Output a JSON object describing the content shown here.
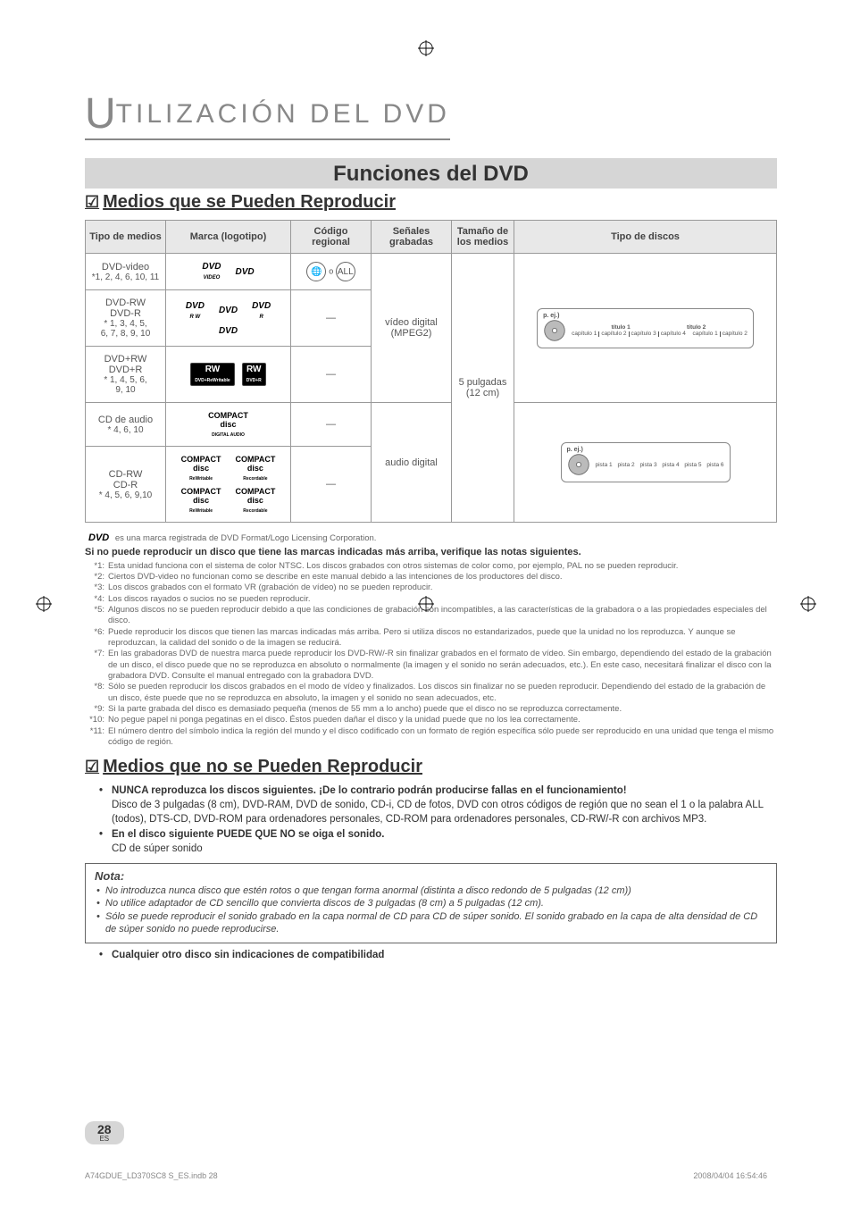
{
  "section_header": "TILIZACIÓN DEL DVD",
  "section_header_bigletter": "U",
  "main_title": "Funciones del DVD",
  "sub1_title": "Medios que se Pueden Reproducir",
  "table": {
    "headers": {
      "type": "Tipo de medios",
      "brand": "Marca (logotipo)",
      "region": "Código regional",
      "signal": "Señales grabadas",
      "size": "Tamaño de los medios",
      "discs": "Tipo de discos"
    },
    "rows": [
      {
        "type": "DVD-video",
        "type_note": "*1, 2, 4, 6, 10, 11",
        "region": "1 o ALL"
      },
      {
        "type": "DVD-RW\nDVD-R",
        "type_note": "* 1, 3, 4, 5,\n6, 7, 8, 9, 10",
        "region": "—"
      },
      {
        "type": "DVD+RW\nDVD+R",
        "type_note": "* 1, 4, 5, 6,\n9, 10",
        "region": "—"
      },
      {
        "type": "CD de audio",
        "type_note": "* 4, 6, 10",
        "region": "—"
      },
      {
        "type": "CD-RW\nCD-R",
        "type_note": "* 4, 5, 6, 9,10",
        "region": "—"
      }
    ],
    "signal_video": "vídeo digital\n(MPEG2)",
    "signal_audio": "audio digital",
    "size": "5 pulgadas\n(12 cm)",
    "diagram_video": {
      "eg": "p. ej.)",
      "t1": "título 1",
      "t2": "título 2",
      "chapters": [
        "capítulo 1",
        "capítulo 2",
        "capítulo 3",
        "capítulo 4",
        "capítulo 1",
        "capítulo 2"
      ]
    },
    "diagram_audio": {
      "eg": "p. ej.)",
      "tracks": [
        "pista 1",
        "pista 2",
        "pista 3",
        "pista 4",
        "pista 5",
        "pista 6"
      ]
    }
  },
  "trademark_line": "es una marca registrada de DVD Format/Logo Licensing Corporation.",
  "bold_warning": "Si no puede reproducir un disco que tiene las marcas indicadas más arriba, verifique las notas siguientes.",
  "footnotes": [
    {
      "n": "*1:",
      "t": "Esta unidad funciona con el sistema de color NTSC. Los discos grabados con otros sistemas de color como, por ejemplo, PAL no se pueden reproducir."
    },
    {
      "n": "*2:",
      "t": "Ciertos DVD-video no funcionan como se describe en este manual debido a las intenciones de los productores del disco."
    },
    {
      "n": "*3:",
      "t": "Los discos grabados con el formato VR (grabación de vídeo) no se pueden reproducir."
    },
    {
      "n": "*4:",
      "t": "Los discos rayados o sucios no se pueden reproducir."
    },
    {
      "n": "*5:",
      "t": "Algunos discos no se pueden reproducir debido a que las condiciones de grabación son incompatibles, a las características de la grabadora o a las propiedades especiales del disco."
    },
    {
      "n": "*6:",
      "t": "Puede reproducir los discos que tienen las marcas indicadas más arriba. Pero si utiliza discos no estandarizados, puede que la unidad no los reproduzca. Y aunque se reproduzcan, la calidad del sonido o de la imagen se reducirá."
    },
    {
      "n": "*7:",
      "t": "En las grabadoras DVD de nuestra marca puede reproducir los DVD-RW/-R sin finalizar grabados en el formato de vídeo. Sin embargo, dependiendo del estado de la grabación de un disco, el disco puede que no se reproduzca en absoluto o normalmente (la imagen y el sonido no serán adecuados, etc.). En este caso, necesitará finalizar el disco con la grabadora DVD. Consulte el manual entregado con la grabadora DVD."
    },
    {
      "n": "*8:",
      "t": "Sólo se pueden reproducir los discos grabados en el modo de vídeo y finalizados. Los discos sin finalizar no se pueden reproducir. Dependiendo del estado de la grabación de un disco, éste puede que no se reproduzca en absoluto, la imagen y el sonido no sean adecuados, etc."
    },
    {
      "n": "*9:",
      "t": "Si la parte grabada del disco es demasiado pequeña (menos de 55 mm a lo ancho) puede que el disco no se reproduzca correctamente."
    },
    {
      "n": "*10:",
      "t": "No pegue papel ni ponga pegatinas en el disco. Éstos pueden dañar el disco y la unidad puede que no los lea correctamente."
    },
    {
      "n": "*11:",
      "t": "El número dentro del símbolo indica la región del mundo y el disco codificado con un formato de región específica sólo puede ser reproducido en una unidad que tenga el mismo código de región."
    }
  ],
  "sub2_title": "Medios que no se Pueden Reproducir",
  "no_play": {
    "b1_bold": "NUNCA reproduzca los discos siguientes. ¡De lo contrario podrán producirse fallas en el funcionamiento!",
    "b1_text": "Disco de 3 pulgadas (8 cm), DVD-RAM, DVD de sonido, CD-i, CD de fotos, DVD con otros códigos de región que no sean el 1 o la palabra ALL (todos), DTS-CD, DVD-ROM para ordenadores personales, CD-ROM para ordenadores personales, CD-RW/-R con archivos MP3.",
    "b2_bold": "En el disco siguiente PUEDE QUE NO se oiga el sonido.",
    "b2_text": "CD de súper sonido"
  },
  "nota": {
    "label": "Nota:",
    "items": [
      "No introduzca nunca disco que estén rotos o que tengan forma anormal (distinta a disco redondo de 5 pulgadas (12 cm))",
      "No utilice adaptador de CD sencillo que convierta discos de 3 pulgadas (8 cm) a 5 pulgadas (12 cm).",
      "Sólo se puede reproducir el sonido grabado en la capa normal de CD para CD de súper sonido. El sonido grabado en la capa de alta densidad de CD de súper sonido no puede reproducirse."
    ]
  },
  "final_bullet": "Cualquier otro disco sin indicaciones de compatibilidad",
  "page_number": "28",
  "page_lang": "ES",
  "footer_left": "A74GDUE_LD370SC8 S_ES.indb   28",
  "footer_right": "2008/04/04   16:54:46"
}
